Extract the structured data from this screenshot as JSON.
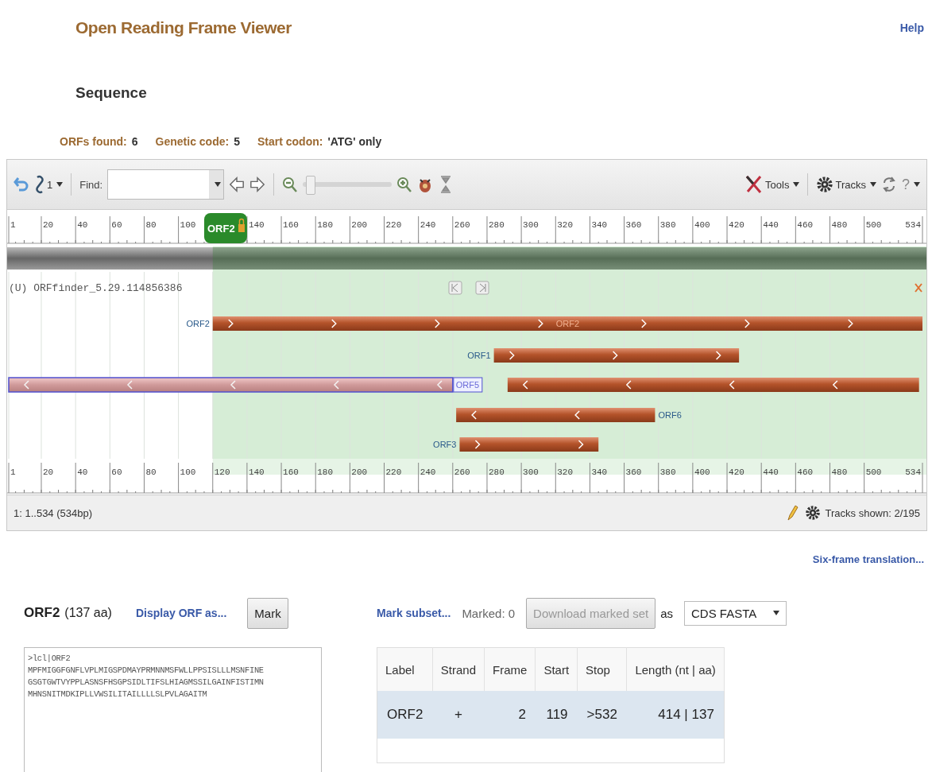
{
  "header": {
    "title": "Open Reading Frame Viewer",
    "help": "Help"
  },
  "section_title": "Sequence",
  "summary": [
    {
      "label": "ORFs found:",
      "value": "6"
    },
    {
      "label": "Genetic code:",
      "value": "5"
    },
    {
      "label": "Start codon:",
      "value": "'ATG' only"
    }
  ],
  "toolbar": {
    "link_count": "1",
    "find_label": "Find:",
    "zoom": {
      "level": 0.03
    },
    "tools": "Tools",
    "tracks": "Tracks",
    "help": "?"
  },
  "ruler_top": {
    "marker": "ORF2",
    "ticks": [
      "1",
      "20",
      "40",
      "60",
      "80",
      "100",
      "140",
      "160",
      "180",
      "200",
      "220",
      "240",
      "260",
      "280",
      "300",
      "320",
      "340",
      "360",
      "380",
      "400",
      "420",
      "440",
      "460",
      "480",
      "500",
      "534"
    ]
  },
  "track": {
    "title": "(U) ORFfinder_5.29.114856386",
    "features": [
      {
        "label": "ORF2",
        "inner_label": "ORF2",
        "reverse": false,
        "selected": false
      },
      {
        "label": "ORF1",
        "reverse": false,
        "selected": false
      },
      {
        "label": "ORF5",
        "reverse": true,
        "selected": true
      },
      {
        "reverse": true,
        "selected": false
      },
      {
        "label": "ORF6",
        "reverse": true,
        "selected": false
      },
      {
        "label": "ORF3",
        "reverse": false,
        "selected": false
      }
    ]
  },
  "ruler_bottom": {
    "ticks": [
      "1",
      "20",
      "40",
      "60",
      "80",
      "100",
      "120",
      "140",
      "160",
      "180",
      "200",
      "220",
      "240",
      "260",
      "280",
      "300",
      "320",
      "340",
      "360",
      "380",
      "400",
      "420",
      "440",
      "460",
      "480",
      "500",
      "534"
    ]
  },
  "status_bar": {
    "range": "1: 1..534 (534bp)",
    "tracks_shown": "Tracks shown: 2/195"
  },
  "six_frame_link": "Six-frame translation...",
  "orf_panel": {
    "name": "ORF2",
    "length": "(137 aa)",
    "display_link": "Display ORF as...",
    "mark_button": "Mark",
    "sequence": [
      ">lcl|ORF2",
      "MPFMIGGFGNFLVPLMIGSPDMAYPRMNNMSFWLLPPSISLLLMSNFINE",
      "GSGTGWTVYPPLASNSFHSGPSIDLTIFSLHIAGMSSILGAINFISTIMN",
      "MHNSNITMDKIPLLVWSILITAILLLLSLPVLAGAITM"
    ]
  },
  "orf_table": {
    "mark_subset": "Mark subset...",
    "marked": "Marked: 0",
    "download": {
      "label": "Download marked set",
      "disabled": true
    },
    "as": "as",
    "format": "CDS FASTA",
    "columns": [
      "Label",
      "Strand",
      "Frame",
      "Start",
      "Stop",
      "Length (nt | aa)"
    ],
    "rows": [
      {
        "cells": [
          "ORF2",
          "+",
          "2",
          "119",
          ">532",
          "414 | 137"
        ],
        "selected": true
      }
    ]
  }
}
